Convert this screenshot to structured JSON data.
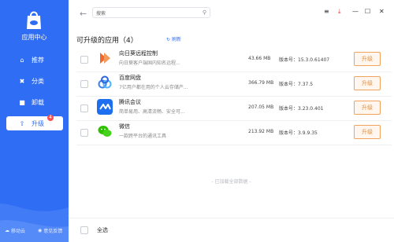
{
  "sidebar": {
    "app_name": "应用中心",
    "items": [
      {
        "label": "推荐"
      },
      {
        "label": "分类"
      },
      {
        "label": "卸载"
      },
      {
        "label": "升级",
        "badge": "4"
      }
    ],
    "footer_left": "移动云",
    "footer_right": "意见反馈"
  },
  "topbar": {
    "search_value": "搜索"
  },
  "main": {
    "title": "可升级的应用（4）",
    "refresh_label": "刷新",
    "version_prefix": "版本号：",
    "update_label": "升级",
    "end_note": "- 已加载全部数据 -",
    "select_all": "全选"
  },
  "apps": [
    {
      "name": "向日葵远程控制",
      "desc": "向日葵客户端国内知名远程...",
      "size": "43.66 MB",
      "version": "15.3.0.61407"
    },
    {
      "name": "百度网盘",
      "desc": "7亿用户都在用的个人云存储产...",
      "size": "366.79 MB",
      "version": "7.37.5"
    },
    {
      "name": "腾讯会议",
      "desc": "简单易用、高清流畅、安全可...",
      "size": "207.05 MB",
      "version": "3.23.0.401"
    },
    {
      "name": "微信",
      "desc": "一款跨平台的通讯工具",
      "size": "213.92 MB",
      "version": "3.9.9.35"
    }
  ],
  "colors": {
    "accent": "#2f6df4",
    "update": "#ef8a2a"
  }
}
